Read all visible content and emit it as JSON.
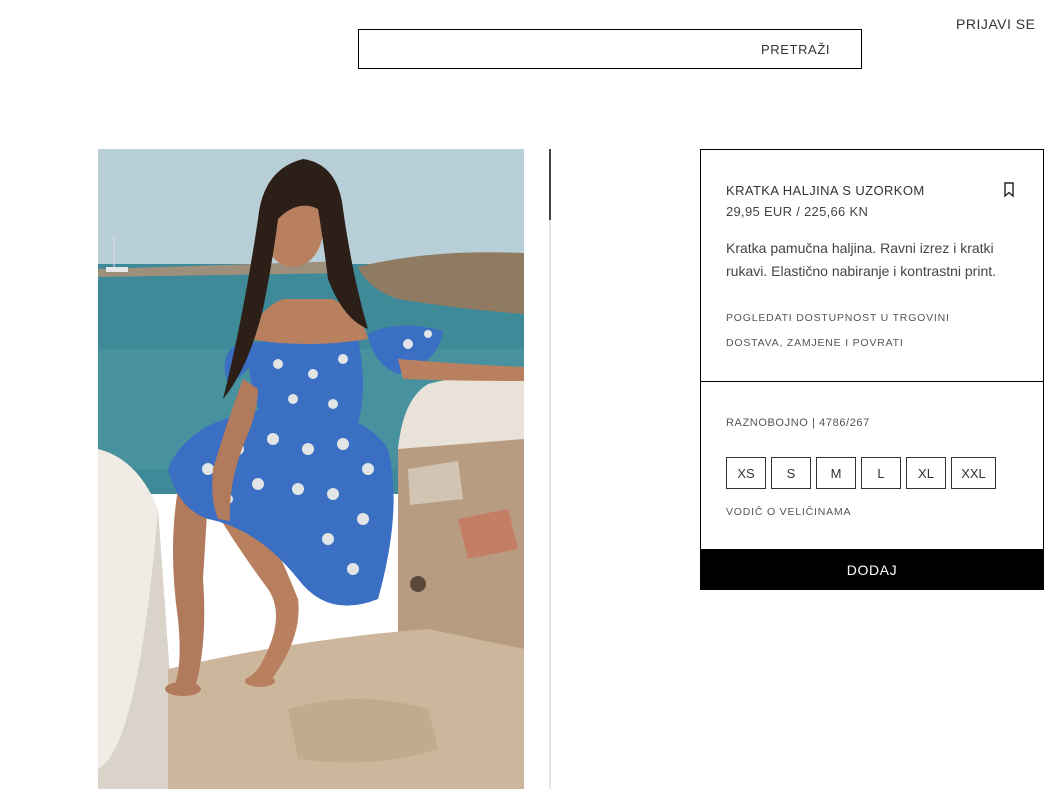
{
  "header": {
    "login_label": "PRIJAVI SE",
    "search_label": "PRETRAŽI"
  },
  "product": {
    "image_alt": "model in blue floral off-shoulder dress sitting on seaside rocks",
    "title": "KRATKA HALJINA S UZORKOM",
    "price": "29,95 EUR / 225,66 KN",
    "description": "Kratka pamučna haljina. Ravni izrez i kratki rukavi. Elastično nabiranje i kontrastni print.",
    "store_availability_label": "POGLEDATI DOSTUPNOST U TRGOVINI",
    "shipping_label": "DOSTAVA, ZAMJENE I POVRATI",
    "color_ref": "RAZNOBOJNO | 4786/267",
    "sizes": [
      "XS",
      "S",
      "M",
      "L",
      "XL",
      "XXL"
    ],
    "size_guide_label": "VODIČ O VELIČINAMA",
    "add_label": "DODAJ",
    "bookmark_icon": "bookmark-icon"
  },
  "colors": {
    "primary": "#000000",
    "background": "#ffffff",
    "dress_blue": "#3a6fc4"
  }
}
